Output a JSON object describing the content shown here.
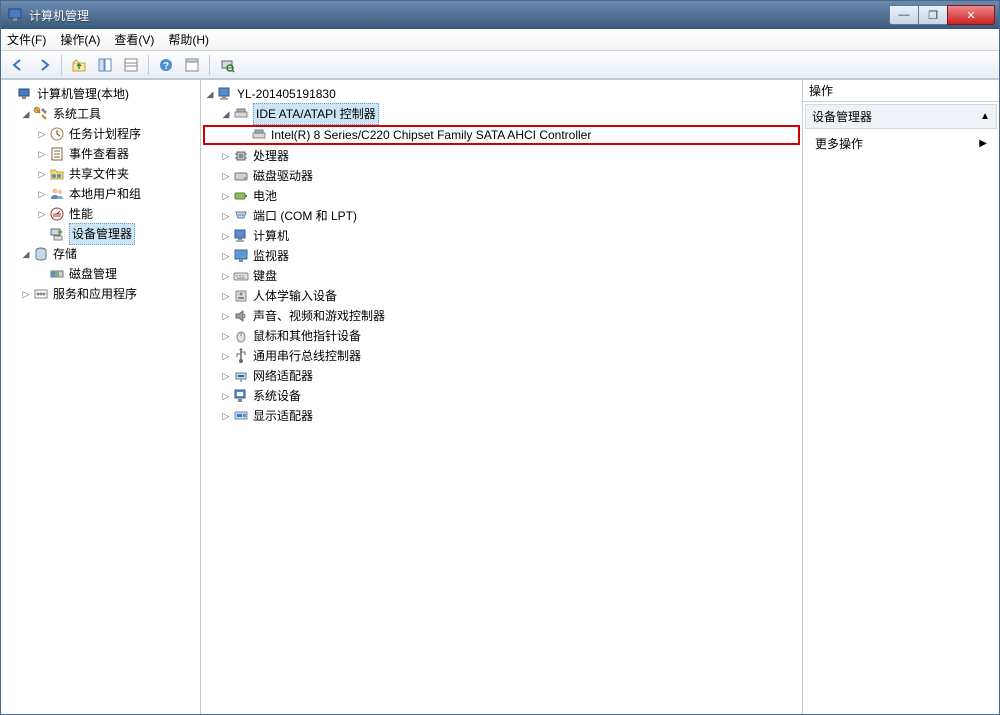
{
  "window": {
    "title": "计算机管理"
  },
  "menubar": {
    "file": "文件(F)",
    "action": "操作(A)",
    "view": "查看(V)",
    "help": "帮助(H)"
  },
  "leftTree": {
    "root": "计算机管理(本地)",
    "systemTools": "系统工具",
    "taskScheduler": "任务计划程序",
    "eventViewer": "事件查看器",
    "sharedFolders": "共享文件夹",
    "localUsers": "本地用户和组",
    "performance": "性能",
    "deviceManager": "设备管理器",
    "storage": "存储",
    "diskMgmt": "磁盘管理",
    "services": "服务和应用程序"
  },
  "midTree": {
    "computer": "YL-201405191830",
    "ideController": "IDE ATA/ATAPI 控制器",
    "sataDevice": "Intel(R) 8 Series/C220 Chipset Family SATA AHCI Controller",
    "processor": "处理器",
    "diskDrives": "磁盘驱动器",
    "battery": "电池",
    "ports": "端口 (COM 和 LPT)",
    "computerCat": "计算机",
    "monitor": "监视器",
    "keyboard": "键盘",
    "hid": "人体学输入设备",
    "sound": "声音、视频和游戏控制器",
    "mouse": "鼠标和其他指针设备",
    "usb": "通用串行总线控制器",
    "network": "网络适配器",
    "systemDevices": "系统设备",
    "display": "显示适配器"
  },
  "actions": {
    "header": "操作",
    "section": "设备管理器",
    "moreOps": "更多操作"
  }
}
